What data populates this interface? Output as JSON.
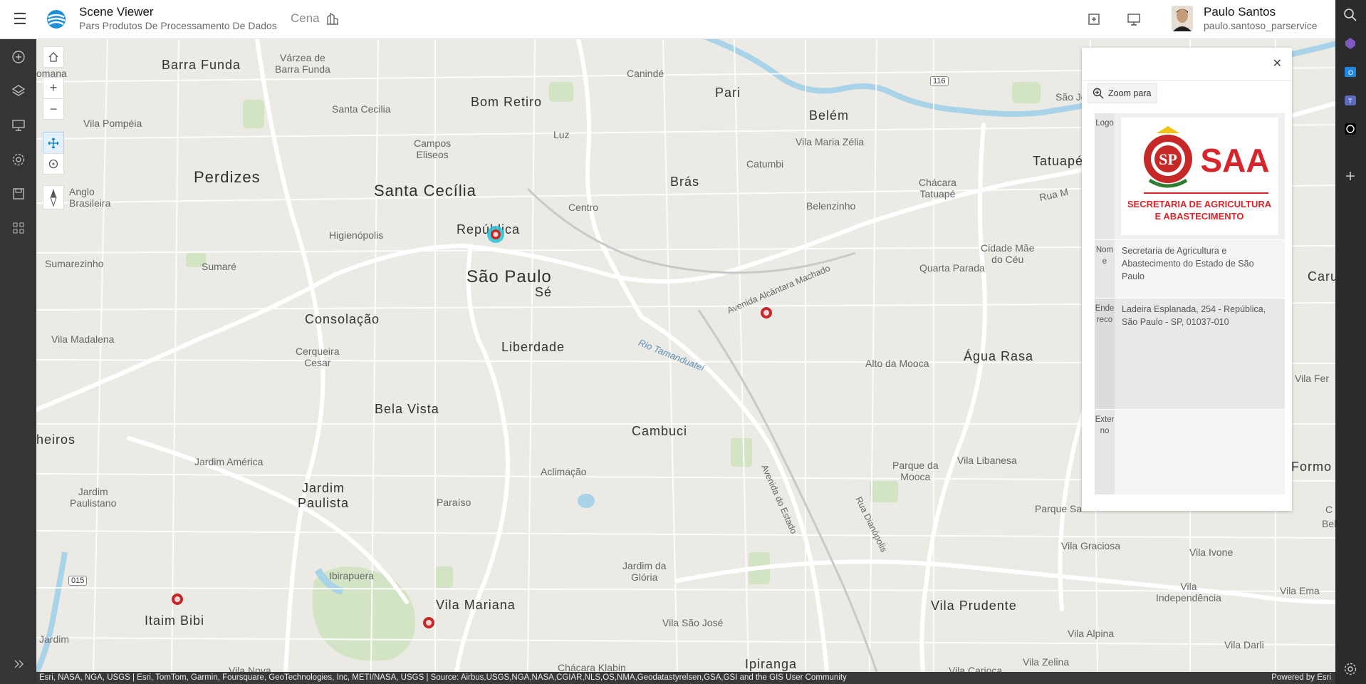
{
  "header": {
    "app_title": "Scene Viewer",
    "subtitle": "Pars Produtos De Processamento De Dados",
    "scene_label": "Cena",
    "user_name": "Paulo Santos",
    "user_handle": "paulo.santoso_parservice"
  },
  "map": {
    "labels": {
      "barra_funda": "Barra Funda",
      "varzea": "Várzea de\nBarra Funda",
      "comana": "omana",
      "vila_pompeia": "Vila Pompéia",
      "santa_cecilia_sm": "Santa Cecilia",
      "bom_retiro": "Bom Retiro",
      "caninde": "Canindé",
      "pari": "Pari",
      "belem": "Belém",
      "vila_maria_zelia": "Vila Maria Zélia",
      "tatuape": "Tatuapé",
      "sao_jo": "São Jo",
      "perdizes": "Perdizes",
      "campos_eliseos": "Campos\nEliseos",
      "luz": "Luz",
      "catumbi": "Catumbi",
      "bras": "Brás",
      "chacara_tatuape": "Chácara\nTatuapé",
      "anglo_brasileira": "Anglo\nBrasileira",
      "santa_cecilia": "Santa Cecília",
      "centro": "Centro",
      "belenzinho": "Belenzinho",
      "rua_melo": "Rua M",
      "republica": "República",
      "higienopolis": "Higienópolis",
      "sumarezinho": "Sumarezinho",
      "sumare": "Sumaré",
      "sao_paulo": "São Paulo",
      "se": "Sé",
      "av_alcantara": "Avenida Alcântara Machado",
      "cidade_mae": "Cidade Mãe\ndo Céu",
      "quarta_parada": "Quarta Parada",
      "caru": "Caru",
      "consolacao": "Consolação",
      "vila_madalena": "Vila Madalena",
      "cerqueira": "Cerqueira\nCesar",
      "liberdade": "Liberdade",
      "rio_tamanduatei": "Rio Tamanduateí",
      "alto_mooca": "Alto da Mooca",
      "agua_rasa": "Água Rasa",
      "vila_fer": "Vila Fer",
      "pinheiros": "heiros",
      "bela_vista": "Bela Vista",
      "cambuci": "Cambuci",
      "jardim_america": "Jardim América",
      "aclimacao": "Aclimação",
      "av_estado": "Avenida do Estado",
      "parque_mooca": "Parque da\nMooca",
      "vila_libanesa": "Vila Libanesa",
      "formo": "Formo",
      "jardim_paulistano": "Jardim\nPaulistano",
      "jardim_paulista": "Jardim\nPaulista",
      "paraiso": "Paraíso",
      "rua_dianopolis": "Rua Dianópolis",
      "parque_sa": "Parque Sa",
      "vila_graciosa": "Vila Graciosa",
      "vila_ivone": "Vila Ivone",
      "ibirapuera": "Ibirapuera",
      "jardim_gloria": "Jardim da\nGlória",
      "vila_independencia": "Vila\nIndependência",
      "vila_ema": "Vila Ema",
      "itaim_bibi": "Itaim Bibi",
      "vila_mariana": "Vila Mariana",
      "vila_prudente": "Vila Prudente",
      "vila_sao_jose": "Vila São José",
      "jardim": "Jardim",
      "vila_alpina": "Vila Alpina",
      "vila_darli": "Vila Darli",
      "vila_zelina": "Vila Zelina",
      "vila_nova": "Vila Nova",
      "chacara_klabin": "Chácara Klabin",
      "ipiranga": "Ipiranga",
      "vila_carioca": "Vila Carioca",
      "bel": "Bel",
      "c_edge": "C",
      "route_116": "116",
      "route_015": "015"
    }
  },
  "popup": {
    "zoom_label": "Zoom para",
    "rows": [
      {
        "key": "Logo",
        "value": ""
      },
      {
        "key": "Nome",
        "value": "Secretaria de Agricultura e Abastecimento do Estado de São Paulo"
      },
      {
        "key": "Endereco",
        "value": "Ladeira Esplanada, 254 - República, São Paulo - SP, 01037-010"
      },
      {
        "key": "Externo",
        "value": ""
      }
    ],
    "logo": {
      "acronym": "SAA",
      "line1": "SECRETARIA DE AGRICULTURA",
      "line2": "E ABASTECIMENTO",
      "seal_text": "SP"
    }
  },
  "attribution": {
    "sources": "Esri, NASA, NGA, USGS | Esri, TomTom, Garmin, Foursquare, GeoTechnologies, Inc, METI/NASA, USGS | Source: Airbus,USGS,NGA,NASA,CGIAR,NLS,OS,NMA,Geodatastyrelsen,GSA,GSI and the GIS User Community",
    "powered_by": "Powered by Esri"
  },
  "colors": {
    "accent": "#0079c1",
    "brand_red": "#d7262b",
    "map_bg": "#eceae4",
    "water": "#a9d3e8",
    "park": "#cfe3bf"
  },
  "icons": [
    "menu-icon",
    "scene-viewer-logo-icon",
    "building-icon",
    "add-icon",
    "present-icon",
    "home-icon",
    "zoom-in-icon",
    "zoom-out-icon",
    "pan-icon",
    "rotate-icon",
    "compass-icon",
    "search-icon",
    "layers-icon",
    "basemap-icon",
    "daylight-icon",
    "measure-icon",
    "share-icon",
    "settings-icon",
    "close-icon",
    "zoom-to-icon",
    "expand-icon"
  ]
}
